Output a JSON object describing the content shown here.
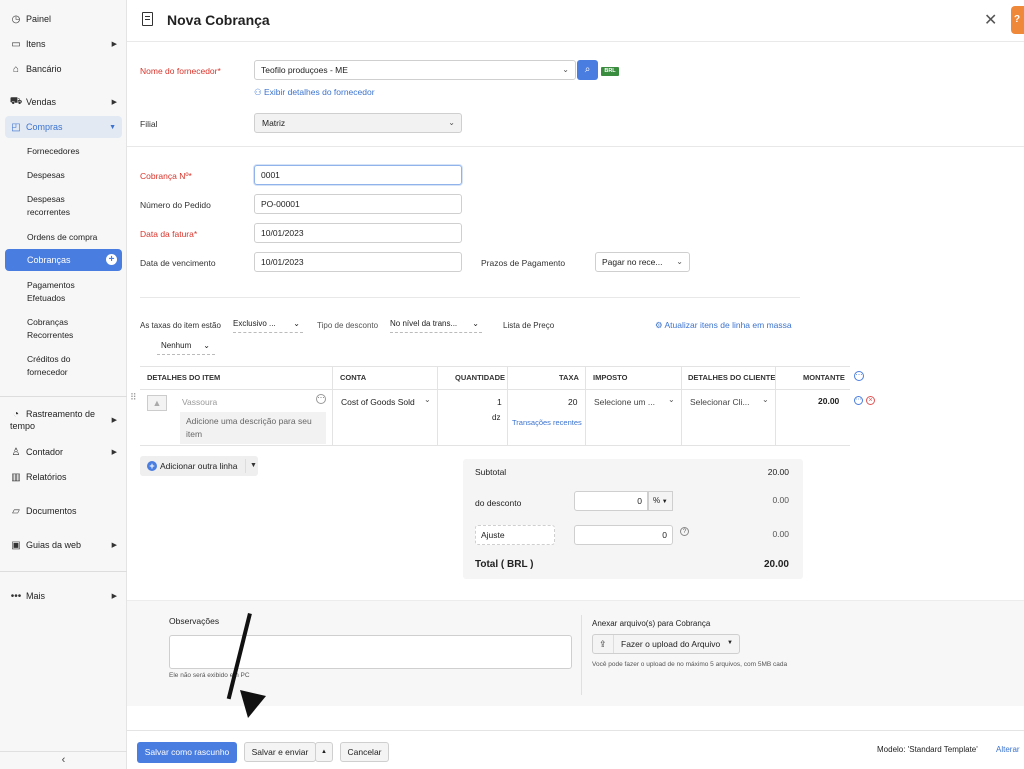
{
  "sidebar": {
    "items": [
      {
        "label": "Painel",
        "icon": "dashboard-icon"
      },
      {
        "label": "Itens",
        "icon": "items-icon"
      },
      {
        "label": "Bancário",
        "icon": "bank-icon"
      },
      {
        "label": "Vendas",
        "icon": "cart-icon"
      },
      {
        "label": "Compras",
        "icon": "bag-icon"
      },
      {
        "label": "Rastreamento de tempo",
        "icon": "clock-icon"
      },
      {
        "label": "Contador",
        "icon": "accountant-icon"
      },
      {
        "label": "Relatórios",
        "icon": "reports-icon"
      },
      {
        "label": "Documentos",
        "icon": "folder-icon"
      },
      {
        "label": "Guias da web",
        "icon": "web-tabs-icon"
      },
      {
        "label": "Mais",
        "icon": "more-icon"
      }
    ],
    "compras_sub": [
      "Fornecedores",
      "Despesas",
      "Despesas recorrentes",
      "Ordens de compra",
      "Cobranças",
      "Pagamentos Efetuados",
      "Cobranças Recorrentes",
      "Créditos do fornecedor"
    ]
  },
  "header": {
    "title": "Nova Cobrança",
    "help": "?"
  },
  "form": {
    "vendor_label": "Nome do fornecedor*",
    "vendor_value": "Teofilo produçoes - ME",
    "currency_badge": "BRL",
    "vendor_details_link": "Exibir detalhes do fornecedor",
    "branch_label": "Filial",
    "branch_value": "Matriz",
    "bill_no_label": "Cobrança Nº*",
    "bill_no_value": "0001",
    "order_no_label": "Número do Pedido",
    "order_no_value": "PO-00001",
    "bill_date_label": "Data da fatura*",
    "bill_date_value": "10/01/2023",
    "due_date_label": "Data de vencimento",
    "due_date_value": "10/01/2023",
    "payment_terms_label": "Prazos de Pagamento",
    "payment_terms_value": "Pagar no rece..."
  },
  "options": {
    "tax_label": "As taxas do item estão",
    "tax_value": "Exclusivo ...",
    "discount_label": "Tipo de desconto",
    "discount_value": "No nível da trans...",
    "pricelist_label": "Lista de Preço",
    "pricelist_value": "Nenhum",
    "bulk_update_link": "Atualizar itens de linha em massa"
  },
  "table": {
    "headers": [
      "DETALHES DO ITEM",
      "CONTA",
      "QUANTIDADE",
      "TAXA",
      "IMPOSTO",
      "DETALHES DO CLIENTE",
      "MONTANTE"
    ],
    "row": {
      "item": "Vassoura",
      "description_placeholder": "Adicione uma descrição para seu item",
      "account": "Cost of Goods Sold",
      "quantity": "1",
      "unit": "dz",
      "rate": "20",
      "recent_transactions": "Transações recentes",
      "tax": "Selecione um ...",
      "customer": "Selecionar Cli...",
      "amount": "20.00"
    },
    "add_row": "Adicionar outra linha"
  },
  "totals": {
    "subtotal_label": "Subtotal",
    "subtotal_value": "20.00",
    "discount_label": "do desconto",
    "discount_input": "0",
    "discount_unit": "%",
    "discount_value": "0.00",
    "adjust_label": "Ajuste",
    "adjust_input": "0",
    "adjust_value": "0.00",
    "total_label": "Total ( BRL )",
    "total_value": "20.00"
  },
  "notes": {
    "label": "Observações",
    "hint": "Ele não será exibido em PC",
    "attach_label": "Anexar arquivo(s) para Cobrança",
    "upload_button": "Fazer o upload do Arquivo",
    "attach_hint": "Você pode fazer o upload de no máximo 5 arquivos, com 5MB cada"
  },
  "footer": {
    "save_draft": "Salvar como rascunho",
    "save_send": "Salvar e enviar",
    "cancel": "Cancelar",
    "template_label": "Modelo:",
    "template_value": "'Standard Template'",
    "change_link": "Alterar"
  },
  "colors": {
    "accent": "#4a7de0",
    "required": "#d9342b",
    "help": "#f0883a",
    "badge": "#3a8c3f"
  }
}
